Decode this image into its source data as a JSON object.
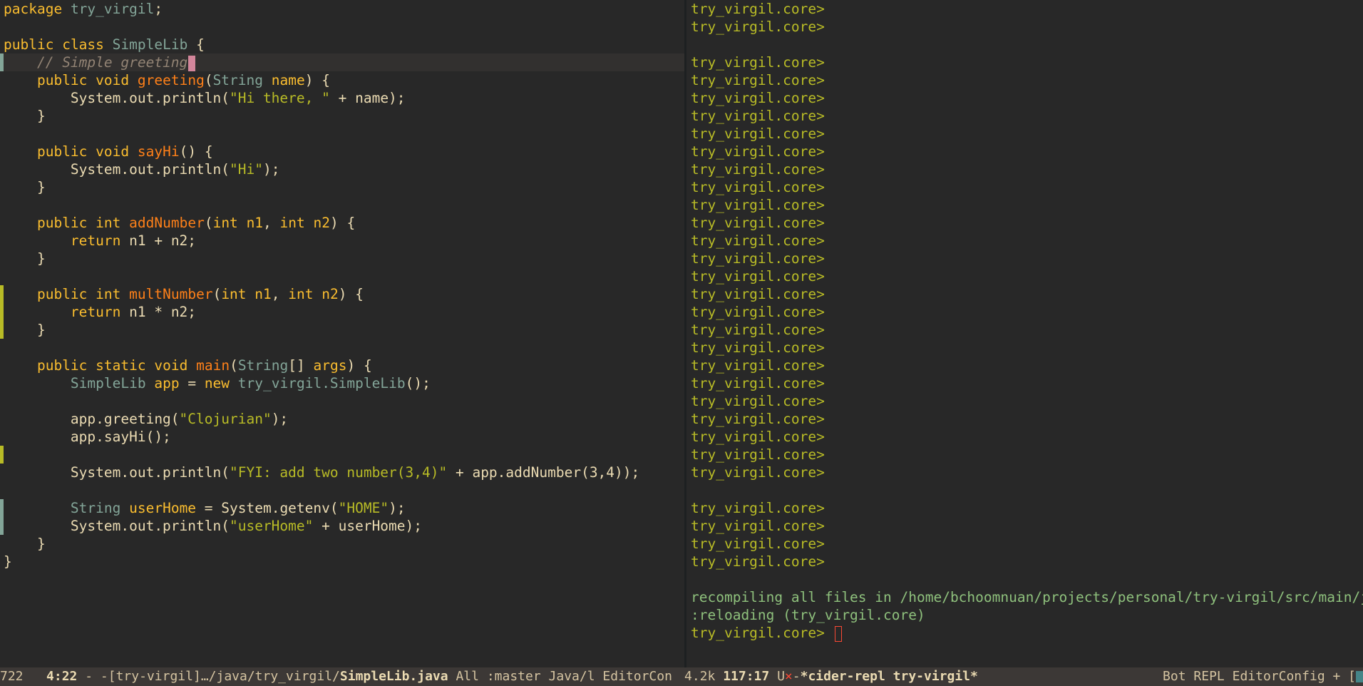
{
  "editor": {
    "code": [
      "package try_virgil;",
      "",
      "public class SimpleLib {",
      "    // Simple greeting",
      "    public void greeting(String name) {",
      "        System.out.println(\"Hi there, \" + name);",
      "    }",
      "",
      "    public void sayHi() {",
      "        System.out.println(\"Hi\");",
      "    }",
      "",
      "    public int addNumber(int n1, int n2) {",
      "        return n1 + n2;",
      "    }",
      "",
      "    public int multNumber(int n1, int n2) {",
      "        return n1 * n2;",
      "    }",
      "",
      "    public static void main(String[] args) {",
      "        SimpleLib app = new try_virgil.SimpleLib();",
      "",
      "        app.greeting(\"Clojurian\");",
      "        app.sayHi();",
      "",
      "        System.out.println(\"FYI: add two number(3,4)\" + app.addNumber(3,4));",
      "",
      "        String userHome = System.getenv(\"HOME\");",
      "        System.out.println(\"userHome\" + userHome);",
      "    }",
      "}"
    ]
  },
  "repl": {
    "prompt": "try_virgil.core>",
    "recompile_msg": "recompiling all files in /home/bchoomnuan/projects/personal/try-virgil/src/main/java",
    "reload_msg": ":reloading (try_virgil.core)"
  },
  "modeline_left": {
    "size": "722",
    "position": "4:22",
    "state": "-",
    "project": "-[try-virgil]",
    "path": "…/java/try_virgil/",
    "filename": "SimpleLib.java",
    "scroll": "All",
    "branch": ":master",
    "mode": "Java/l",
    "minor": "EditorCon"
  },
  "modeline_right": {
    "size": "4.2k",
    "position": "117:17",
    "flags_prefix": "U",
    "flags_mark": "×",
    "flags_suffix": "-",
    "buffer": "*cider-repl try-virgil*",
    "scroll": "Bot",
    "mode": "REPL",
    "minor": "EditorConfig + ["
  },
  "colors": {
    "background": "#282828",
    "keyword": "#fabd2f",
    "type": "#83a598",
    "function": "#fe8019",
    "string": "#b8bb26",
    "comment": "#928374",
    "repl_prompt": "#b8bb26",
    "repl_message": "#8ec07c"
  }
}
